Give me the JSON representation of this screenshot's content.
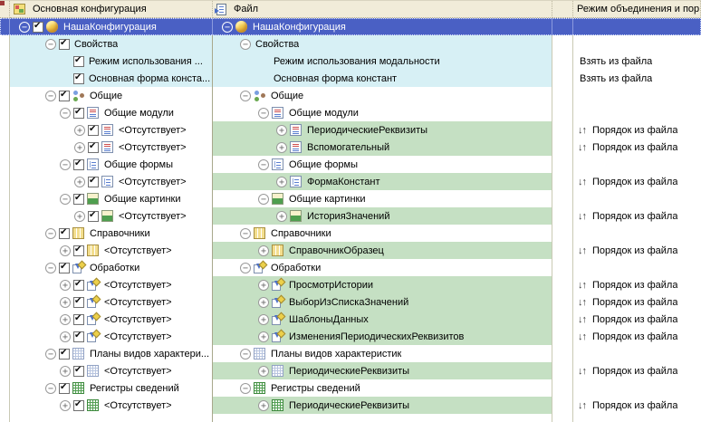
{
  "header": {
    "col_main": "Основная конфигурация",
    "col_file": "Файл",
    "col_mode": "Режим объединения и пор"
  },
  "labels": {
    "take_from_file": "Взять из файла",
    "order_from_file": "Порядок из файла",
    "updown_icon": "↓↑"
  },
  "colors": {
    "selection": "#4a60c4",
    "changed_row": "#d7f0f5",
    "added_row": "#c5e0c3",
    "header_bg": "#f1ecd9"
  },
  "rows": [
    {
      "bg": "sel",
      "mode": "none",
      "main": {
        "level": 0,
        "expander": "minus",
        "checkbox": true,
        "icon": "configuration",
        "label": "НашаКонфигурация"
      },
      "file": {
        "level": 0,
        "expander": "minus",
        "icon": "configuration",
        "label": "НашаКонфигурация"
      }
    },
    {
      "bg": "prop",
      "mode": "none",
      "main": {
        "level": 1,
        "expander": "minus",
        "checkbox": true,
        "icon": "",
        "label": "Свойства"
      },
      "file": {
        "level": 1,
        "expander": "minus",
        "icon": "",
        "label": "Свойства"
      }
    },
    {
      "bg": "prop",
      "mode": "take",
      "main": {
        "level": 2,
        "expander": "slot",
        "checkbox": true,
        "icon": "",
        "label": "Режим использования ..."
      },
      "file": {
        "level": 2,
        "expander": "slot",
        "icon": "",
        "label": "Режим использования модальности"
      }
    },
    {
      "bg": "prop",
      "mode": "take",
      "main": {
        "level": 2,
        "expander": "slot",
        "checkbox": true,
        "icon": "",
        "label": "Основная форма конста..."
      },
      "file": {
        "level": 2,
        "expander": "slot",
        "icon": "",
        "label": "Основная форма констант"
      }
    },
    {
      "bg": "plain",
      "mode": "none",
      "main": {
        "level": 1,
        "expander": "minus",
        "checkbox": true,
        "icon": "common",
        "label": "Общие"
      },
      "file": {
        "level": 1,
        "expander": "minus",
        "icon": "common",
        "label": "Общие"
      }
    },
    {
      "bg": "plain",
      "mode": "none",
      "main": {
        "level": 2,
        "expander": "minus",
        "checkbox": true,
        "icon": "module",
        "label": "Общие модули"
      },
      "file": {
        "level": 2,
        "expander": "minus",
        "icon": "module",
        "label": "Общие модули"
      }
    },
    {
      "bg": "new",
      "mode": "order",
      "main": {
        "level": 3,
        "expander": "plus",
        "checkbox": true,
        "icon": "module",
        "label": "<Отсутствует>"
      },
      "file": {
        "level": 3,
        "expander": "plus",
        "icon": "module",
        "label": "ПериодическиеРеквизиты"
      }
    },
    {
      "bg": "new",
      "mode": "order",
      "main": {
        "level": 3,
        "expander": "plus",
        "checkbox": true,
        "icon": "module",
        "label": "<Отсутствует>"
      },
      "file": {
        "level": 3,
        "expander": "plus",
        "icon": "module",
        "label": "Вспомогательный"
      }
    },
    {
      "bg": "plain",
      "mode": "none",
      "main": {
        "level": 2,
        "expander": "minus",
        "checkbox": true,
        "icon": "form",
        "label": "Общие формы"
      },
      "file": {
        "level": 2,
        "expander": "minus",
        "icon": "form",
        "label": "Общие формы"
      }
    },
    {
      "bg": "new",
      "mode": "order",
      "main": {
        "level": 3,
        "expander": "plus",
        "checkbox": true,
        "icon": "form",
        "label": "<Отсутствует>"
      },
      "file": {
        "level": 3,
        "expander": "plus",
        "icon": "form",
        "label": "ФормаКонстант"
      }
    },
    {
      "bg": "plain",
      "mode": "none",
      "main": {
        "level": 2,
        "expander": "minus",
        "checkbox": true,
        "icon": "picture",
        "label": "Общие картинки"
      },
      "file": {
        "level": 2,
        "expander": "minus",
        "icon": "picture",
        "label": "Общие картинки"
      }
    },
    {
      "bg": "new",
      "mode": "order",
      "main": {
        "level": 3,
        "expander": "plus",
        "checkbox": true,
        "icon": "picture",
        "label": "<Отсутствует>"
      },
      "file": {
        "level": 3,
        "expander": "plus",
        "icon": "picture",
        "label": "ИсторияЗначений"
      }
    },
    {
      "bg": "plain",
      "mode": "none",
      "main": {
        "level": 1,
        "expander": "minus",
        "checkbox": true,
        "icon": "catalog",
        "label": "Справочники"
      },
      "file": {
        "level": 1,
        "expander": "minus",
        "icon": "catalog",
        "label": "Справочники"
      }
    },
    {
      "bg": "new",
      "mode": "order",
      "main": {
        "level": 2,
        "expander": "plus",
        "checkbox": true,
        "icon": "catalog",
        "label": "<Отсутствует>"
      },
      "file": {
        "level": 2,
        "expander": "plus",
        "icon": "catalog",
        "label": "СправочникОбразец"
      }
    },
    {
      "bg": "plain",
      "mode": "none",
      "main": {
        "level": 1,
        "expander": "minus",
        "checkbox": true,
        "icon": "dataprocessor",
        "label": "Обработки"
      },
      "file": {
        "level": 1,
        "expander": "minus",
        "icon": "dataprocessor",
        "label": "Обработки"
      }
    },
    {
      "bg": "new",
      "mode": "order",
      "main": {
        "level": 2,
        "expander": "plus",
        "checkbox": true,
        "icon": "dataprocessor",
        "label": "<Отсутствует>"
      },
      "file": {
        "level": 2,
        "expander": "plus",
        "icon": "dataprocessor",
        "label": "ПросмотрИстории"
      }
    },
    {
      "bg": "new",
      "mode": "order",
      "main": {
        "level": 2,
        "expander": "plus",
        "checkbox": true,
        "icon": "dataprocessor",
        "label": "<Отсутствует>"
      },
      "file": {
        "level": 2,
        "expander": "plus",
        "icon": "dataprocessor",
        "label": "ВыборИзСпискаЗначений"
      }
    },
    {
      "bg": "new",
      "mode": "order",
      "main": {
        "level": 2,
        "expander": "plus",
        "checkbox": true,
        "icon": "dataprocessor",
        "label": "<Отсутствует>"
      },
      "file": {
        "level": 2,
        "expander": "plus",
        "icon": "dataprocessor",
        "label": "ШаблоныДанных"
      }
    },
    {
      "bg": "new",
      "mode": "order",
      "main": {
        "level": 2,
        "expander": "plus",
        "checkbox": true,
        "icon": "dataprocessor",
        "label": "<Отсутствует>"
      },
      "file": {
        "level": 2,
        "expander": "plus",
        "icon": "dataprocessor",
        "label": "ИзмененияПериодическихРеквизитов"
      }
    },
    {
      "bg": "plain",
      "mode": "none",
      "main": {
        "level": 1,
        "expander": "minus",
        "checkbox": true,
        "icon": "cchart",
        "label": "Планы видов характери..."
      },
      "file": {
        "level": 1,
        "expander": "minus",
        "icon": "cchart",
        "label": "Планы видов характеристик"
      }
    },
    {
      "bg": "new",
      "mode": "order",
      "main": {
        "level": 2,
        "expander": "plus",
        "checkbox": true,
        "icon": "cchart",
        "label": "<Отсутствует>"
      },
      "file": {
        "level": 2,
        "expander": "plus",
        "icon": "cchart",
        "label": "ПериодическиеРеквизиты"
      }
    },
    {
      "bg": "plain",
      "mode": "none",
      "main": {
        "level": 1,
        "expander": "minus",
        "checkbox": true,
        "icon": "inforeg",
        "label": "Регистры сведений"
      },
      "file": {
        "level": 1,
        "expander": "minus",
        "icon": "inforeg",
        "label": "Регистры сведений"
      }
    },
    {
      "bg": "new",
      "mode": "order",
      "main": {
        "level": 2,
        "expander": "plus",
        "checkbox": true,
        "icon": "inforeg",
        "label": "<Отсутствует>"
      },
      "file": {
        "level": 2,
        "expander": "plus",
        "icon": "inforeg",
        "label": "ПериодическиеРеквизиты"
      }
    }
  ]
}
